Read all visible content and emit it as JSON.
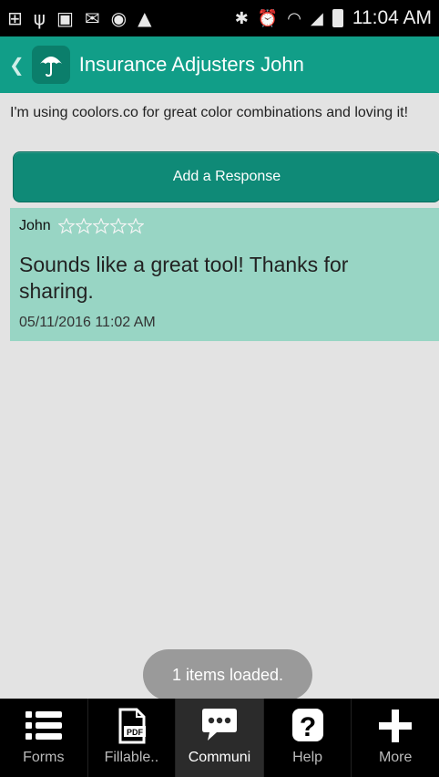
{
  "status_bar": {
    "time": "11:04 AM",
    "icons": [
      "add-icon",
      "usb-icon",
      "image-icon",
      "mms-icon",
      "lock-icon",
      "warning-icon",
      "bluetooth-icon",
      "alarm-icon",
      "wifi-icon",
      "signal-icon",
      "battery-icon"
    ]
  },
  "header": {
    "back_icon": "chevron-left-icon",
    "app_icon": "umbrella-icon",
    "title": "Insurance Adjusters John"
  },
  "message": {
    "text": "I'm using coolors.co for great color combinations and loving it!"
  },
  "add_response": {
    "label": "Add a Response"
  },
  "responses": [
    {
      "author": "John",
      "rating": 0,
      "max_rating": 5,
      "text": "Sounds like a great tool! Thanks for sharing.",
      "date": "05/11/2016 11:02 AM"
    }
  ],
  "toast": {
    "text": "1 items loaded."
  },
  "bottom_nav": {
    "items": [
      {
        "label": "Forms",
        "icon": "list-icon"
      },
      {
        "label": "Fillable..",
        "icon": "pdf-icon"
      },
      {
        "label": "Communi",
        "icon": "chat-icon"
      },
      {
        "label": "Help",
        "icon": "help-icon"
      },
      {
        "label": "More",
        "icon": "plus-icon"
      }
    ],
    "active_label": "Communi"
  },
  "colors": {
    "actionbar": "#119e88",
    "button": "#0f8a77",
    "card": "#98d5c4",
    "background": "#e3e3e3"
  }
}
